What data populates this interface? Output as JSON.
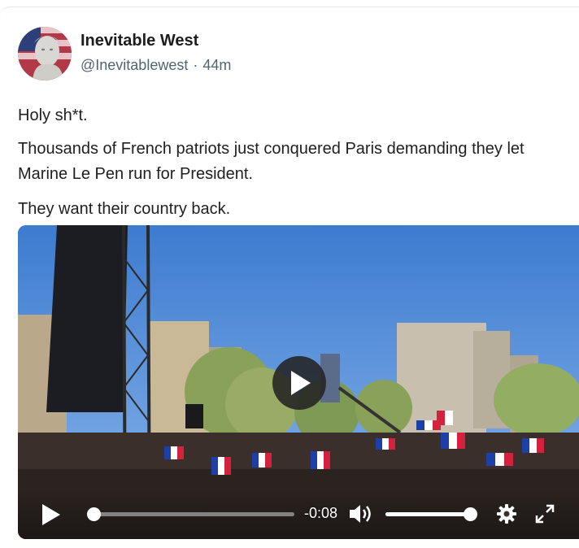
{
  "post": {
    "author_name": "Inevitable West",
    "handle": "@Inevitablewest",
    "separator": "·",
    "time_ago": "44m",
    "paragraphs": [
      "Holy sh*t.",
      "Thousands of French patriots just conquered Paris demanding they let Marine Le Pen run for President.",
      "They want their country back."
    ]
  },
  "video": {
    "time_remaining": "-0:08",
    "progress_fraction": 0.02,
    "volume_fraction": 1.0,
    "icons": {
      "big_play": "play-icon",
      "play": "play-icon",
      "volume": "volume-icon",
      "settings": "gear-icon",
      "fullscreen": "fullscreen-icon"
    }
  },
  "colors": {
    "text_primary": "#1f1f1f",
    "text_secondary": "#536471",
    "sky": "#4d88d6"
  }
}
